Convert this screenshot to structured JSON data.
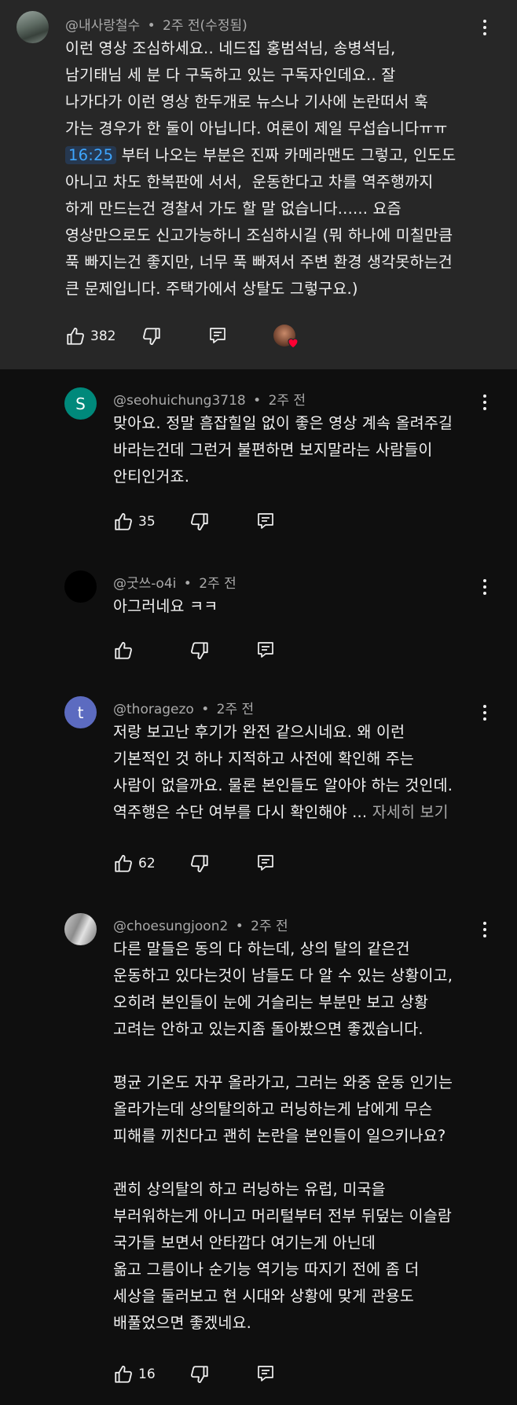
{
  "top_comment": {
    "handle": "@내사랑철수",
    "time": "2주 전(수정됨)",
    "separator": "•",
    "text_before": "이런 영상 조심하세요.. 네드집 홍범석님, 송병석님,\n남기태님 세 분 다 구독하고 있는 구독자인데요.. 잘\n나가다가 이런 영상 한두개로 뉴스나 기사에 논란떠서 훅\n가는 경우가 한 둘이 아닙니다. 여론이 제일 무섭습니다ㅠㅠ\n",
    "timestamp": "16:25",
    "text_after": " 부터 나오는 부분은 진짜 카메라맨도 그렇고, 인도도\n아니고 차도 한복판에 서서,  운동한다고 차를 역주행까지\n하게 만드는건 경찰서 가도 할 말 없습니다...... 요즘\n영상만으로도 신고가능하니 조심하시길 (뭐 하나에 미칠만큼\n푹 빠지는건 좋지만, 너무 푹 빠져서 주변 환경 생각못하는건\n큰 문제입니다. 주택가에서 상탈도 그렇구요.)",
    "likes": "382"
  },
  "replies": [
    {
      "handle": "@seohuichung3718",
      "time": "2주 전",
      "avatar_letter": "S",
      "avatar_color": "#00897b",
      "text": "맞아요. 정말 흠잡힐일 없이 좋은 영상 계속 올려주길\n바라는건데 그런거 불편하면 보지말라는 사람들이\n안티인거죠.",
      "likes": "35"
    },
    {
      "handle": "@굿쓰-o4i",
      "time": "2주 전",
      "avatar_letter": "",
      "avatar_color": "#000000",
      "text": "아그러네요 ㅋㅋ",
      "likes": ""
    },
    {
      "handle": "@thoragezo",
      "time": "2주 전",
      "avatar_letter": "t",
      "avatar_color": "#5c6bc0",
      "text": "저랑 보고난 후기가 완전 같으시네요. 왜 이런\n기본적인 것 하나 지적하고 사전에 확인해 주는\n사람이 없을까요. 물론 본인들도 알아야 하는 것인데.\n역주행은 수단 여부를 다시 확인해야 ...",
      "more": " 자세히 보기",
      "likes": "62"
    },
    {
      "handle": "@choesungjoon2",
      "time": "2주 전",
      "avatar_letter": "",
      "avatar_color": "#8a8a8a",
      "text": "다른 말들은 동의 다 하는데, 상의 탈의 같은건\n운동하고 있다는것이 남들도 다 알 수 있는 상황이고,\n오히려 본인들이 눈에 거슬리는 부분만 보고 상황\n고려는 안하고 있는지좀 돌아봤으면 좋겠습니다.\n\n평균 기온도 자꾸 올라가고, 그러는 와중 운동 인기는\n올라가는데 상의탈의하고 러닝하는게 남에게 무슨\n피해를 끼친다고 괜히 논란을 본인들이 일으키나요?\n\n괜히 상의탈의 하고 러닝하는 유럽, 미국을\n부러워하는게 아니고 머리털부터 전부 뒤덮는 이슬람\n국가들 보면서 안타깝다 여기는게 아닌데\n옮고 그름이나 순기능 역기능 따지기 전에 좀 더\n세상을 둘러보고 현 시대와 상황에 맞게 관용도\n배풀었으면 좋겠네요.",
      "likes": "16"
    }
  ],
  "colors": {
    "top_background": "#272727",
    "page_background": "#0f0f0f",
    "timestamp_link": "#3ea6ff",
    "heart": "#ff0033"
  }
}
